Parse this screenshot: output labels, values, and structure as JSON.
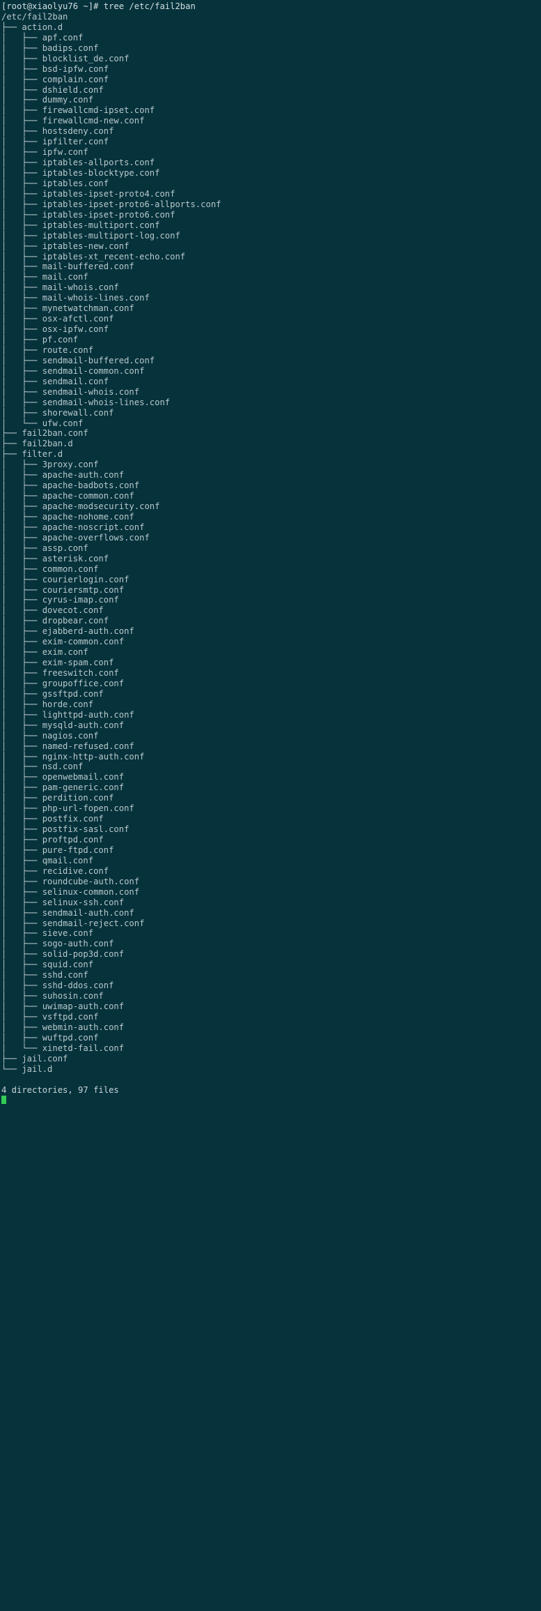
{
  "terminal": {
    "background_color": "#06323c",
    "foreground_color": "#c9d6d8",
    "cursor_color": "#33cc55",
    "prompt": "[root@xiaolyu76 ~]# tree /etc/fail2ban",
    "root_path": "/etc/fail2ban",
    "summary": "4 directories, 97 files",
    "lines": [
      "[root@xiaolyu76 ~]# tree /etc/fail2ban",
      "/etc/fail2ban",
      "├── action.d",
      "│   ├── apf.conf",
      "│   ├── badips.conf",
      "│   ├── blocklist_de.conf",
      "│   ├── bsd-ipfw.conf",
      "│   ├── complain.conf",
      "│   ├── dshield.conf",
      "│   ├── dummy.conf",
      "│   ├── firewallcmd-ipset.conf",
      "│   ├── firewallcmd-new.conf",
      "│   ├── hostsdeny.conf",
      "│   ├── ipfilter.conf",
      "│   ├── ipfw.conf",
      "│   ├── iptables-allports.conf",
      "│   ├── iptables-blocktype.conf",
      "│   ├── iptables.conf",
      "│   ├── iptables-ipset-proto4.conf",
      "│   ├── iptables-ipset-proto6-allports.conf",
      "│   ├── iptables-ipset-proto6.conf",
      "│   ├── iptables-multiport.conf",
      "│   ├── iptables-multiport-log.conf",
      "│   ├── iptables-new.conf",
      "│   ├── iptables-xt_recent-echo.conf",
      "│   ├── mail-buffered.conf",
      "│   ├── mail.conf",
      "│   ├── mail-whois.conf",
      "│   ├── mail-whois-lines.conf",
      "│   ├── mynetwatchman.conf",
      "│   ├── osx-afctl.conf",
      "│   ├── osx-ipfw.conf",
      "│   ├── pf.conf",
      "│   ├── route.conf",
      "│   ├── sendmail-buffered.conf",
      "│   ├── sendmail-common.conf",
      "│   ├── sendmail.conf",
      "│   ├── sendmail-whois.conf",
      "│   ├── sendmail-whois-lines.conf",
      "│   ├── shorewall.conf",
      "│   └── ufw.conf",
      "├── fail2ban.conf",
      "├── fail2ban.d",
      "├── filter.d",
      "│   ├── 3proxy.conf",
      "│   ├── apache-auth.conf",
      "│   ├── apache-badbots.conf",
      "│   ├── apache-common.conf",
      "│   ├── apache-modsecurity.conf",
      "│   ├── apache-nohome.conf",
      "│   ├── apache-noscript.conf",
      "│   ├── apache-overflows.conf",
      "│   ├── assp.conf",
      "│   ├── asterisk.conf",
      "│   ├── common.conf",
      "│   ├── courierlogin.conf",
      "│   ├── couriersmtp.conf",
      "│   ├── cyrus-imap.conf",
      "│   ├── dovecot.conf",
      "│   ├── dropbear.conf",
      "│   ├── ejabberd-auth.conf",
      "│   ├── exim-common.conf",
      "│   ├── exim.conf",
      "│   ├── exim-spam.conf",
      "│   ├── freeswitch.conf",
      "│   ├── groupoffice.conf",
      "│   ├── gssftpd.conf",
      "│   ├── horde.conf",
      "│   ├── lighttpd-auth.conf",
      "│   ├── mysqld-auth.conf",
      "│   ├── nagios.conf",
      "│   ├── named-refused.conf",
      "│   ├── nginx-http-auth.conf",
      "│   ├── nsd.conf",
      "│   ├── openwebmail.conf",
      "│   ├── pam-generic.conf",
      "│   ├── perdition.conf",
      "│   ├── php-url-fopen.conf",
      "│   ├── postfix.conf",
      "│   ├── postfix-sasl.conf",
      "│   ├── proftpd.conf",
      "│   ├── pure-ftpd.conf",
      "│   ├── qmail.conf",
      "│   ├── recidive.conf",
      "│   ├── roundcube-auth.conf",
      "│   ├── selinux-common.conf",
      "│   ├── selinux-ssh.conf",
      "│   ├── sendmail-auth.conf",
      "│   ├── sendmail-reject.conf",
      "│   ├── sieve.conf",
      "│   ├── sogo-auth.conf",
      "│   ├── solid-pop3d.conf",
      "│   ├── squid.conf",
      "│   ├── sshd.conf",
      "│   ├── sshd-ddos.conf",
      "│   ├── suhosin.conf",
      "│   ├── uwimap-auth.conf",
      "│   ├── vsftpd.conf",
      "│   ├── webmin-auth.conf",
      "│   ├── wuftpd.conf",
      "│   └── xinetd-fail.conf",
      "├── jail.conf",
      "└── jail.d",
      "",
      "4 directories, 97 files"
    ]
  }
}
